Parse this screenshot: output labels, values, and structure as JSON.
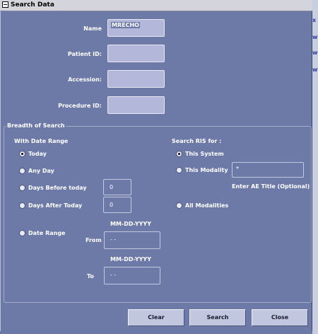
{
  "window": {
    "title": "Search Data"
  },
  "fields": {
    "name_label": "Name",
    "name_value": "MRECHO",
    "patient_id_label": "Patient ID:",
    "patient_id_value": "",
    "accession_label": "Accession:",
    "accession_value": "",
    "procedure_id_label": "Procedure ID:",
    "procedure_id_value": ""
  },
  "breadth": {
    "group_label": "Breadth of Search",
    "date_heading": "With Date Range",
    "today": "Today",
    "any_day": "Any Day",
    "days_before": "Days Before today",
    "days_before_value": "0",
    "days_after": "Days After Today",
    "days_after_value": "0",
    "date_range": "Date Range",
    "from_format": "MM-DD-YYYY",
    "from_label": "From",
    "from_value": "-  -",
    "to_format": "MM-DD-YYYY",
    "to_label": "To",
    "to_value": "-  -",
    "selected_date_option": "Today"
  },
  "ris": {
    "heading": "Search RIS for :",
    "this_system": "This System",
    "this_modality": "This Modality",
    "ae_title_value": "*",
    "ae_title_hint": "Enter AE Title (Optional)",
    "all_modalities": "All Modalities",
    "selected_option": "This System"
  },
  "buttons": {
    "clear": "Clear",
    "search": "Search",
    "close": "Close"
  }
}
